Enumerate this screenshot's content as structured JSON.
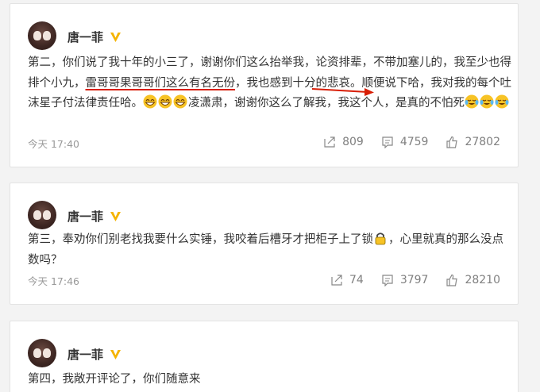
{
  "colors": {
    "accent_red": "#d81e06",
    "vip_gold": "#f5b400",
    "emoji_yellow": "#f7c325"
  },
  "posts": [
    {
      "author": "唐一菲",
      "text_1": "第二，你们说了我十年的小三了，谢谢你们这么抬举我，论资排辈，不带加塞儿的，我至少也得排个小九，",
      "text_underlined": "雷哥哥果哥哥们这么有名无份",
      "text_2": "，我也感到十分的悲哀。顺便说下哈，我对我的每个吐沫星子付法律责任哈。",
      "text_3": "凌潇肃，谢谢你这么了解我，我这个人，是真的不怕死",
      "time": "今天 17:40",
      "reposts": "809",
      "comments": "4759",
      "likes": "27802"
    },
    {
      "author": "唐一菲",
      "text_1": "第三，奉劝你们别老找我要什么实锤，我咬着后槽牙才把柜子上了锁",
      "text_2": "，心里就真的那么没点 数吗？",
      "time": "今天 17:46",
      "reposts": "74",
      "comments": "3797",
      "likes": "28210"
    },
    {
      "author": "唐一菲",
      "text_1": "第四，我敞开评论了，你们随意来"
    }
  ]
}
